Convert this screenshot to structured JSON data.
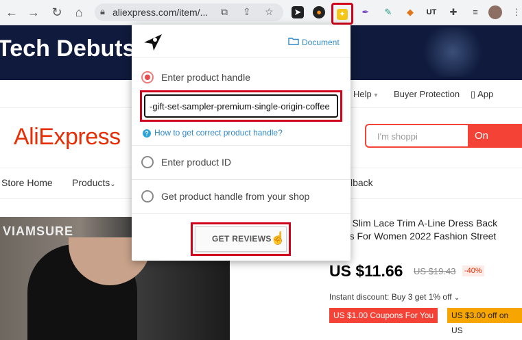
{
  "browser": {
    "url": "aliexpress.com/item/...",
    "extensions": [
      "telegram-icon",
      "crypto-icon",
      "product-reviews-ext-icon",
      "feather-icon",
      "edit-icon",
      "fox-icon",
      "tasks-icon",
      "puzzle-icon",
      "playlist-icon",
      "avatar"
    ]
  },
  "page": {
    "banner_title": "Tech Debuts",
    "topbar": {
      "help": "Help",
      "buyer_protection": "Buyer Protection",
      "app": "App"
    },
    "logo": "AliExpress",
    "search": {
      "placeholder": "I'm shoppi",
      "button": "On AliExpr"
    },
    "nav": {
      "store_home": "Store Home",
      "products": "Products",
      "feedback": "lback"
    },
    "brand_mark": "VIAMSURE",
    "product_title": "URE Slim Lace Trim A-Line Dress Back esses For Women 2022 Fashion Street",
    "price": "US $11.66",
    "old_price": "US $19.43",
    "discount": "-40%",
    "instant_discount": "Instant discount: Buy 3 get 1% off",
    "coupons": [
      "US $1.00 Coupons For You",
      "US $3.00 off on US"
    ]
  },
  "popup": {
    "document_link": "Document",
    "options": [
      {
        "label": "Enter product handle",
        "selected": true
      },
      {
        "label": "Enter product ID",
        "selected": false
      },
      {
        "label": "Get product handle from your shop",
        "selected": false
      }
    ],
    "handle_value": "-gift-set-sampler-premium-single-origin-coffee",
    "help_link": "How to get correct product handle?",
    "submit": "GET REVIEWS"
  },
  "colors": {
    "accent": "#d0021b",
    "aliexpress_red": "#e62e04",
    "link": "#2f88c8",
    "radio_on": "#e94b4b"
  }
}
